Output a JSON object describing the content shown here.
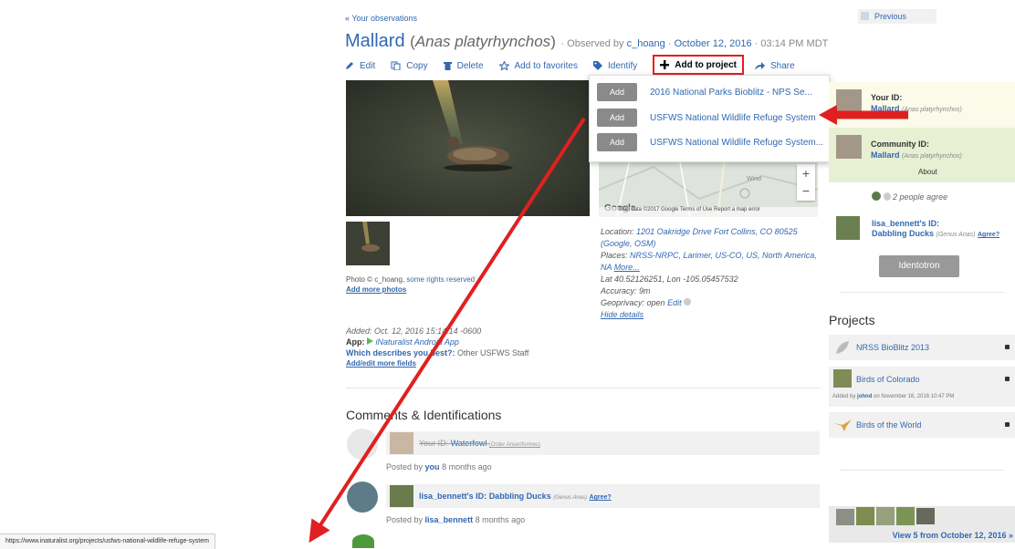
{
  "nav": {
    "back": "« Your observations",
    "previous": "Previous"
  },
  "title": {
    "common": "Mallard",
    "scientific": "Anas platyrhynchos",
    "observed_by_prefix": "· Observed by",
    "user": "c_hoang",
    "sep": "·",
    "date": "October 12, 2016",
    "time": "· 03:14 PM MDT"
  },
  "toolbar": {
    "edit": "Edit",
    "copy": "Copy",
    "delete": "Delete",
    "favorites": "Add to favorites",
    "identify": "Identify",
    "add_project": "Add to project",
    "share": "Share"
  },
  "dropdown": {
    "add_label": "Add",
    "items": [
      "2016 National Parks Bioblitz - NPS Se...",
      "USFWS National Wildlife Refuge System",
      "USFWS National Wildlife Refuge System..."
    ]
  },
  "map": {
    "footer": "Map data ©2017 Google   Terms of Use   Report a map error",
    "label": "Wind",
    "google": "Google"
  },
  "photo_credit": {
    "prefix": "Photo © c_hoang,",
    "link": "some rights reserved",
    "add_more": "Add more photos"
  },
  "details": {
    "location_prefix": "Location:",
    "location": "1201 Oakridge Drive Fort Collins, CO 80525",
    "location_links": "(Google, OSM)",
    "places_prefix": "Places:",
    "places": "NRSS-NRPC, Larimer, US-CO, US, North America, NA",
    "places_more": "More...",
    "latlon": "Lat 40.52126251, Lon -105.05457532",
    "accuracy": "Accuracy: 9m",
    "geoprivacy_prefix": "Geoprivacy: open",
    "geoprivacy_edit": "Edit",
    "hide": "Hide details"
  },
  "added": {
    "added": "Added: Oct. 12, 2016 15:14:14 -0600",
    "app_prefix": "App:",
    "app": "iNaturalist Android App",
    "which_q": "Which describes you best?:",
    "which_a": "Other USFWS Staff",
    "add_fields": "Add/edit more fields"
  },
  "comments": {
    "title": "Comments & Identifications",
    "items": [
      {
        "who": "Your ID:",
        "taxon": "Waterfowl",
        "rank": "(Order Anseriformes)",
        "posted_prefix": "Posted by",
        "user": "you",
        "ago": "8 months ago"
      },
      {
        "who": "lisa_bennett's ID:",
        "taxon": "Dabbling Ducks",
        "rank": "(Genus Anas)",
        "agree": "Agree?",
        "posted_prefix": "Posted by",
        "user": "lisa_bennett",
        "ago": "8 months ago"
      }
    ]
  },
  "sidebar": {
    "your_id_label": "Your ID:",
    "your_id_name": "Mallard",
    "your_id_sci": "(Anas platyrhynchos)",
    "community_label": "Community ID:",
    "community_name": "Mallard",
    "community_sci": "(Anas platyrhynchos)",
    "about": "About",
    "agree_count": "2 people agree",
    "lisa_label": "lisa_bennett's ID:",
    "lisa_name": "Dabbling Ducks",
    "lisa_rank": "(Genus Anas)",
    "lisa_agree": "Agree?",
    "identotron": "Identotron",
    "projects_title": "Projects",
    "projects": [
      {
        "name": "NRSS BioBlitz 2013"
      },
      {
        "name": "Birds of Colorado",
        "added_prefix": "Added by",
        "added_user": "johnd",
        "added_date": "on November 16, 2016 10:47 PM"
      },
      {
        "name": "Birds of the World"
      }
    ],
    "view_more": "View 5 from October 12, 2016 »"
  },
  "status_url": "https://www.inaturalist.org/projects/usfws-national-wildlife-refuge-system",
  "colors": {
    "link": "#3268b1",
    "annotation": "#e02020",
    "your_id_bg": "#fbfbea",
    "community_bg": "#e7f0d3"
  }
}
